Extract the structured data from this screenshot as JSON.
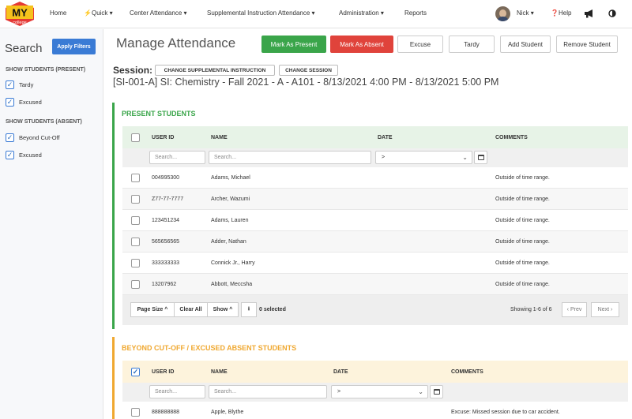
{
  "nav": {
    "logo_text": "MY",
    "logo_sub": "college",
    "items": [
      "Home",
      "Quick",
      "Center Attendance",
      "Supplemental Instruction Attendance",
      "Administration",
      "Reports"
    ],
    "user": "Nick",
    "help": "Help"
  },
  "sidebar": {
    "title": "Search",
    "apply_label": "Apply Filters",
    "present_heading": "SHOW STUDENTS (PRESENT)",
    "present_options": [
      "Tardy",
      "Excused"
    ],
    "absent_heading": "SHOW STUDENTS (ABSENT)",
    "absent_options": [
      "Beyond Cut-Off",
      "Excused"
    ]
  },
  "header": {
    "title": "Manage Attendance",
    "buttons": {
      "present": "Mark As Present",
      "absent": "Mark As Absent",
      "excuse": "Excuse",
      "tardy": "Tardy",
      "add": "Add Student",
      "remove": "Remove Student"
    }
  },
  "session": {
    "label": "Session:",
    "change_si": "CHANGE SUPPLEMENTAL INSTRUCTION",
    "change_session": "CHANGE SESSION",
    "name": "[SI-001-A] SI: Chemistry - Fall 2021 - A - A101 - 8/13/2021 4:00 PM - 8/13/2021 5:00 PM"
  },
  "present": {
    "title": "PRESENT STUDENTS",
    "columns": [
      "USER ID",
      "NAME",
      "DATE",
      "COMMENTS"
    ],
    "search_placeholder": "Search...",
    "date_op": ">",
    "rows": [
      {
        "id": "004995300",
        "name": "Adams, Michael",
        "comment": "Outside of time range."
      },
      {
        "id": "Z77-77-7777",
        "name": "Archer, Wazumi",
        "comment": "Outside of time range."
      },
      {
        "id": "123451234",
        "name": "Adams, Lauren",
        "comment": "Outside of time range."
      },
      {
        "id": "565656565",
        "name": "Adder, Nathan",
        "comment": "Outside of time range."
      },
      {
        "id": "333333333",
        "name": "Connick Jr., Harry",
        "comment": "Outside of time range."
      },
      {
        "id": "13207962",
        "name": "Abbott, Meccsha",
        "comment": "Outside of time range."
      }
    ],
    "footer": {
      "page_size": "Page Size",
      "clear_all": "Clear All",
      "show": "Show",
      "selected": "0 selected",
      "showing": "Showing 1-6 of 6",
      "prev": "Prev",
      "next": "Next"
    }
  },
  "absent": {
    "title": "BEYOND CUT-OFF / EXCUSED ABSENT STUDENTS",
    "columns": [
      "USER ID",
      "NAME",
      "DATE",
      "COMMENTS"
    ],
    "search_placeholder": "Search...",
    "date_op": ">",
    "rows": [
      {
        "id": "888888888",
        "name": "Apple, Blythe",
        "comment": "Excuse: Missed session due to car accident."
      }
    ]
  },
  "colors": {
    "green": "#3aa54a",
    "red": "#e0433b",
    "blue": "#3a7bd5",
    "present_accent": "#3aa54a",
    "absent_accent": "#f0a830"
  }
}
